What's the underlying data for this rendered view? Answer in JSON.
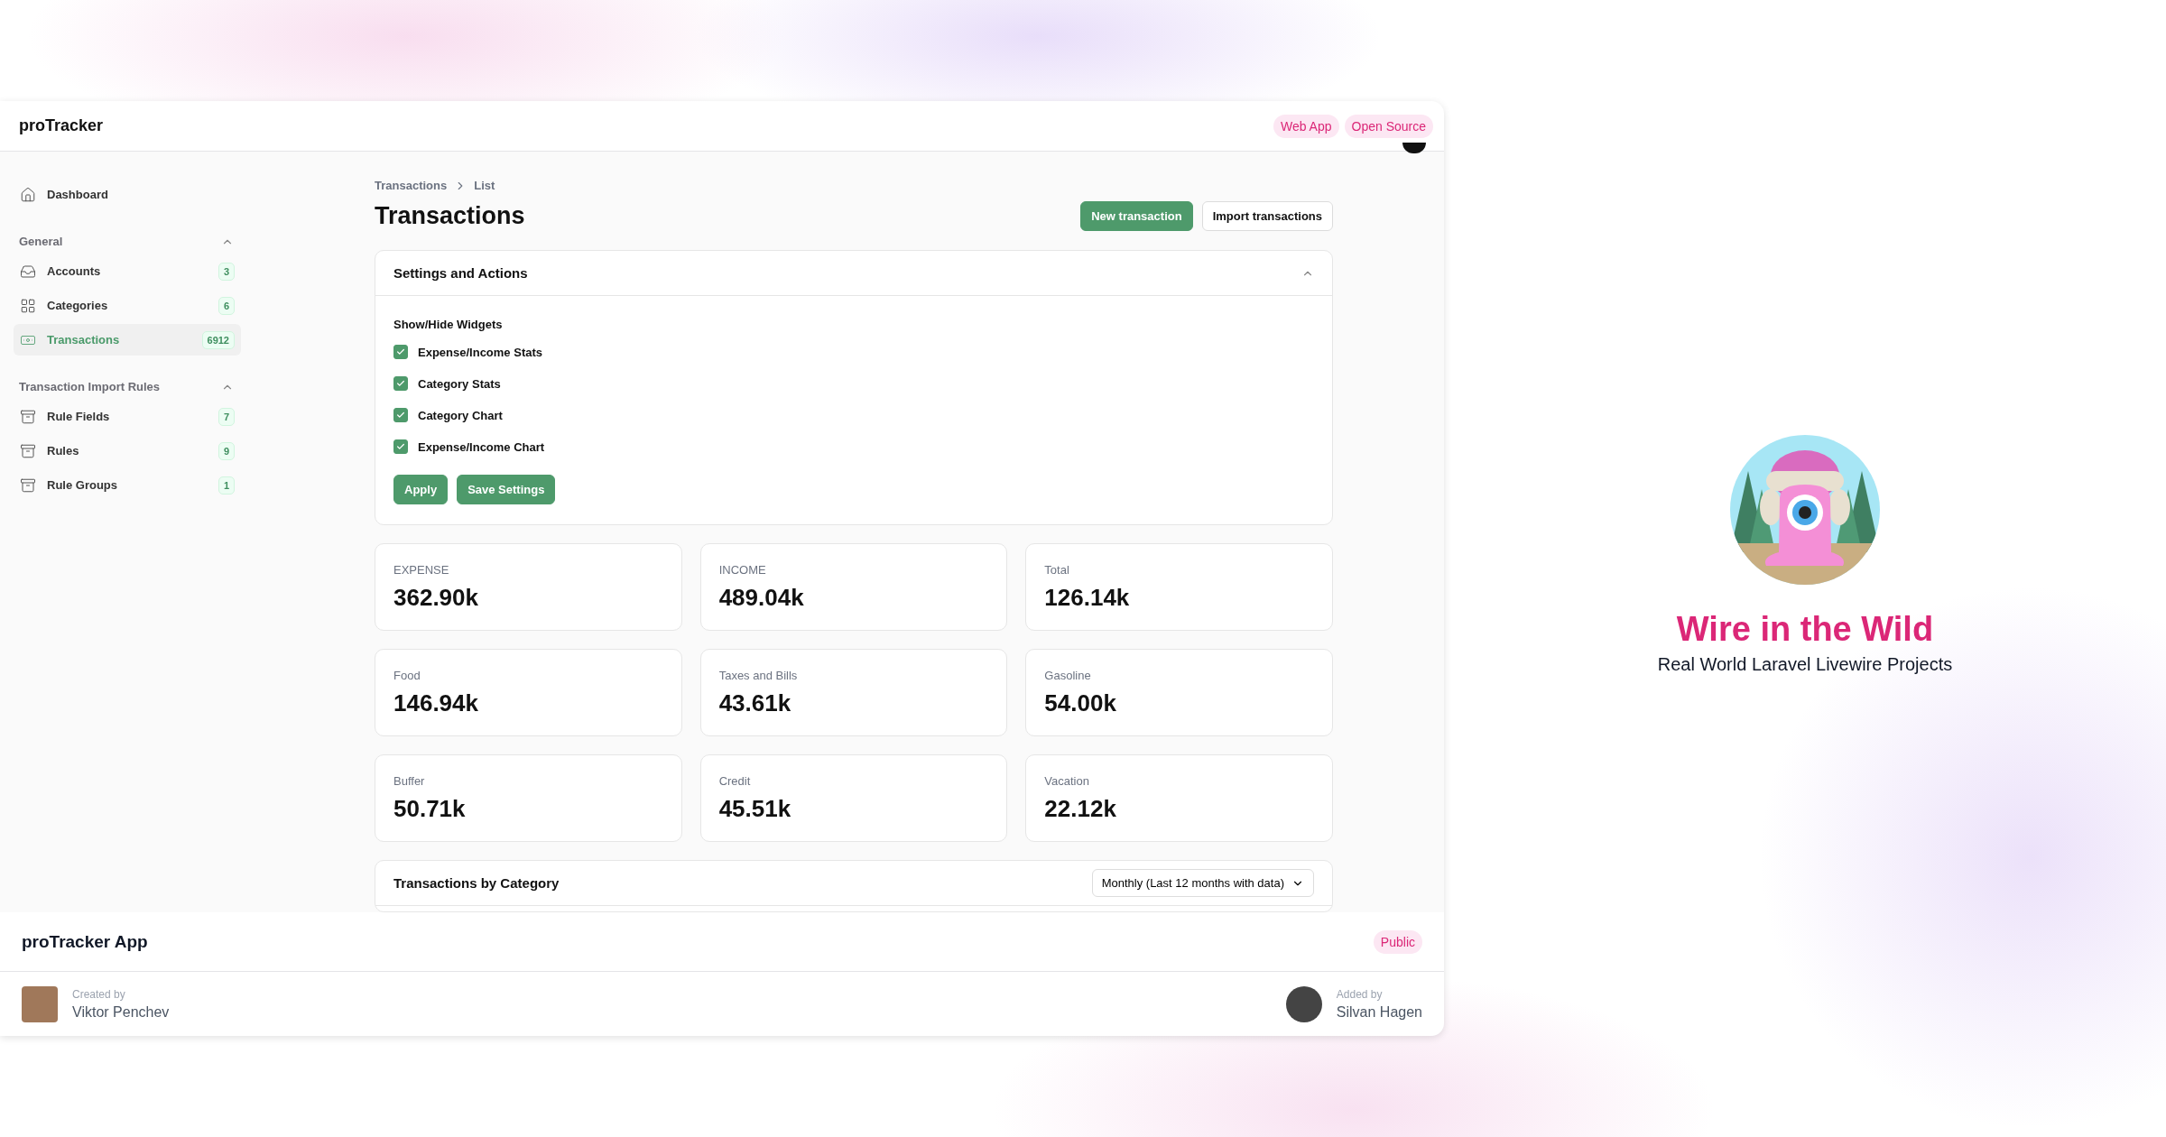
{
  "app": {
    "brand": "proTracker",
    "header_badges": [
      "Web App",
      "Open Source"
    ]
  },
  "sidebar": {
    "top_items": [
      {
        "label": "Dashboard",
        "kind": "home",
        "selected": false
      }
    ],
    "groups": [
      {
        "title": "General",
        "expanded": true,
        "items": [
          {
            "label": "Accounts",
            "kind": "inbox",
            "count": "3",
            "selected": false
          },
          {
            "label": "Categories",
            "kind": "grid",
            "count": "6",
            "selected": false
          },
          {
            "label": "Transactions",
            "kind": "banknote",
            "count": "6912",
            "selected": true
          }
        ]
      },
      {
        "title": "Transaction Import Rules",
        "expanded": true,
        "items": [
          {
            "label": "Rule Fields",
            "kind": "archive",
            "count": "7",
            "selected": false
          },
          {
            "label": "Rules",
            "kind": "archive",
            "count": "9",
            "selected": false
          },
          {
            "label": "Rule Groups",
            "kind": "archive",
            "count": "1",
            "selected": false
          }
        ]
      }
    ]
  },
  "breadcrumbs": [
    "Transactions",
    "List"
  ],
  "page_title": "Transactions",
  "actions": [
    {
      "label": "New transaction",
      "kind": "primary"
    },
    {
      "label": "Import transactions",
      "kind": "secondary"
    }
  ],
  "settings_panel": {
    "title": "Settings and Actions",
    "expanded": true,
    "section_label": "Show/Hide Widgets",
    "options": [
      {
        "label": "Expense/Income Stats",
        "checked": true
      },
      {
        "label": "Category Stats",
        "checked": true
      },
      {
        "label": "Category Chart",
        "checked": true
      },
      {
        "label": "Expense/Income Chart",
        "checked": true
      }
    ],
    "buttons": [
      "Apply",
      "Save Settings"
    ]
  },
  "stats": [
    {
      "label": "EXPENSE",
      "value": "362.90k"
    },
    {
      "label": "INCOME",
      "value": "489.04k"
    },
    {
      "label": "Total",
      "value": "126.14k"
    },
    {
      "label": "Food",
      "value": "146.94k"
    },
    {
      "label": "Taxes and Bills",
      "value": "43.61k"
    },
    {
      "label": "Gasoline",
      "value": "54.00k"
    },
    {
      "label": "Buffer",
      "value": "50.71k"
    },
    {
      "label": "Credit",
      "value": "45.51k"
    },
    {
      "label": "Vacation",
      "value": "22.12k"
    }
  ],
  "chart_panel": {
    "title": "Transactions by Category",
    "period": "Monthly (Last 12 months with data)"
  },
  "project": {
    "name": "proTracker App",
    "badge": "Public",
    "creator": {
      "caption": "Created by",
      "name": "Viktor Penchev"
    },
    "adder": {
      "caption": "Added by",
      "name": "Silvan Hagen"
    }
  },
  "showcase": {
    "title": "Wire in the Wild",
    "subtitle": "Real World Laravel Livewire Projects"
  }
}
